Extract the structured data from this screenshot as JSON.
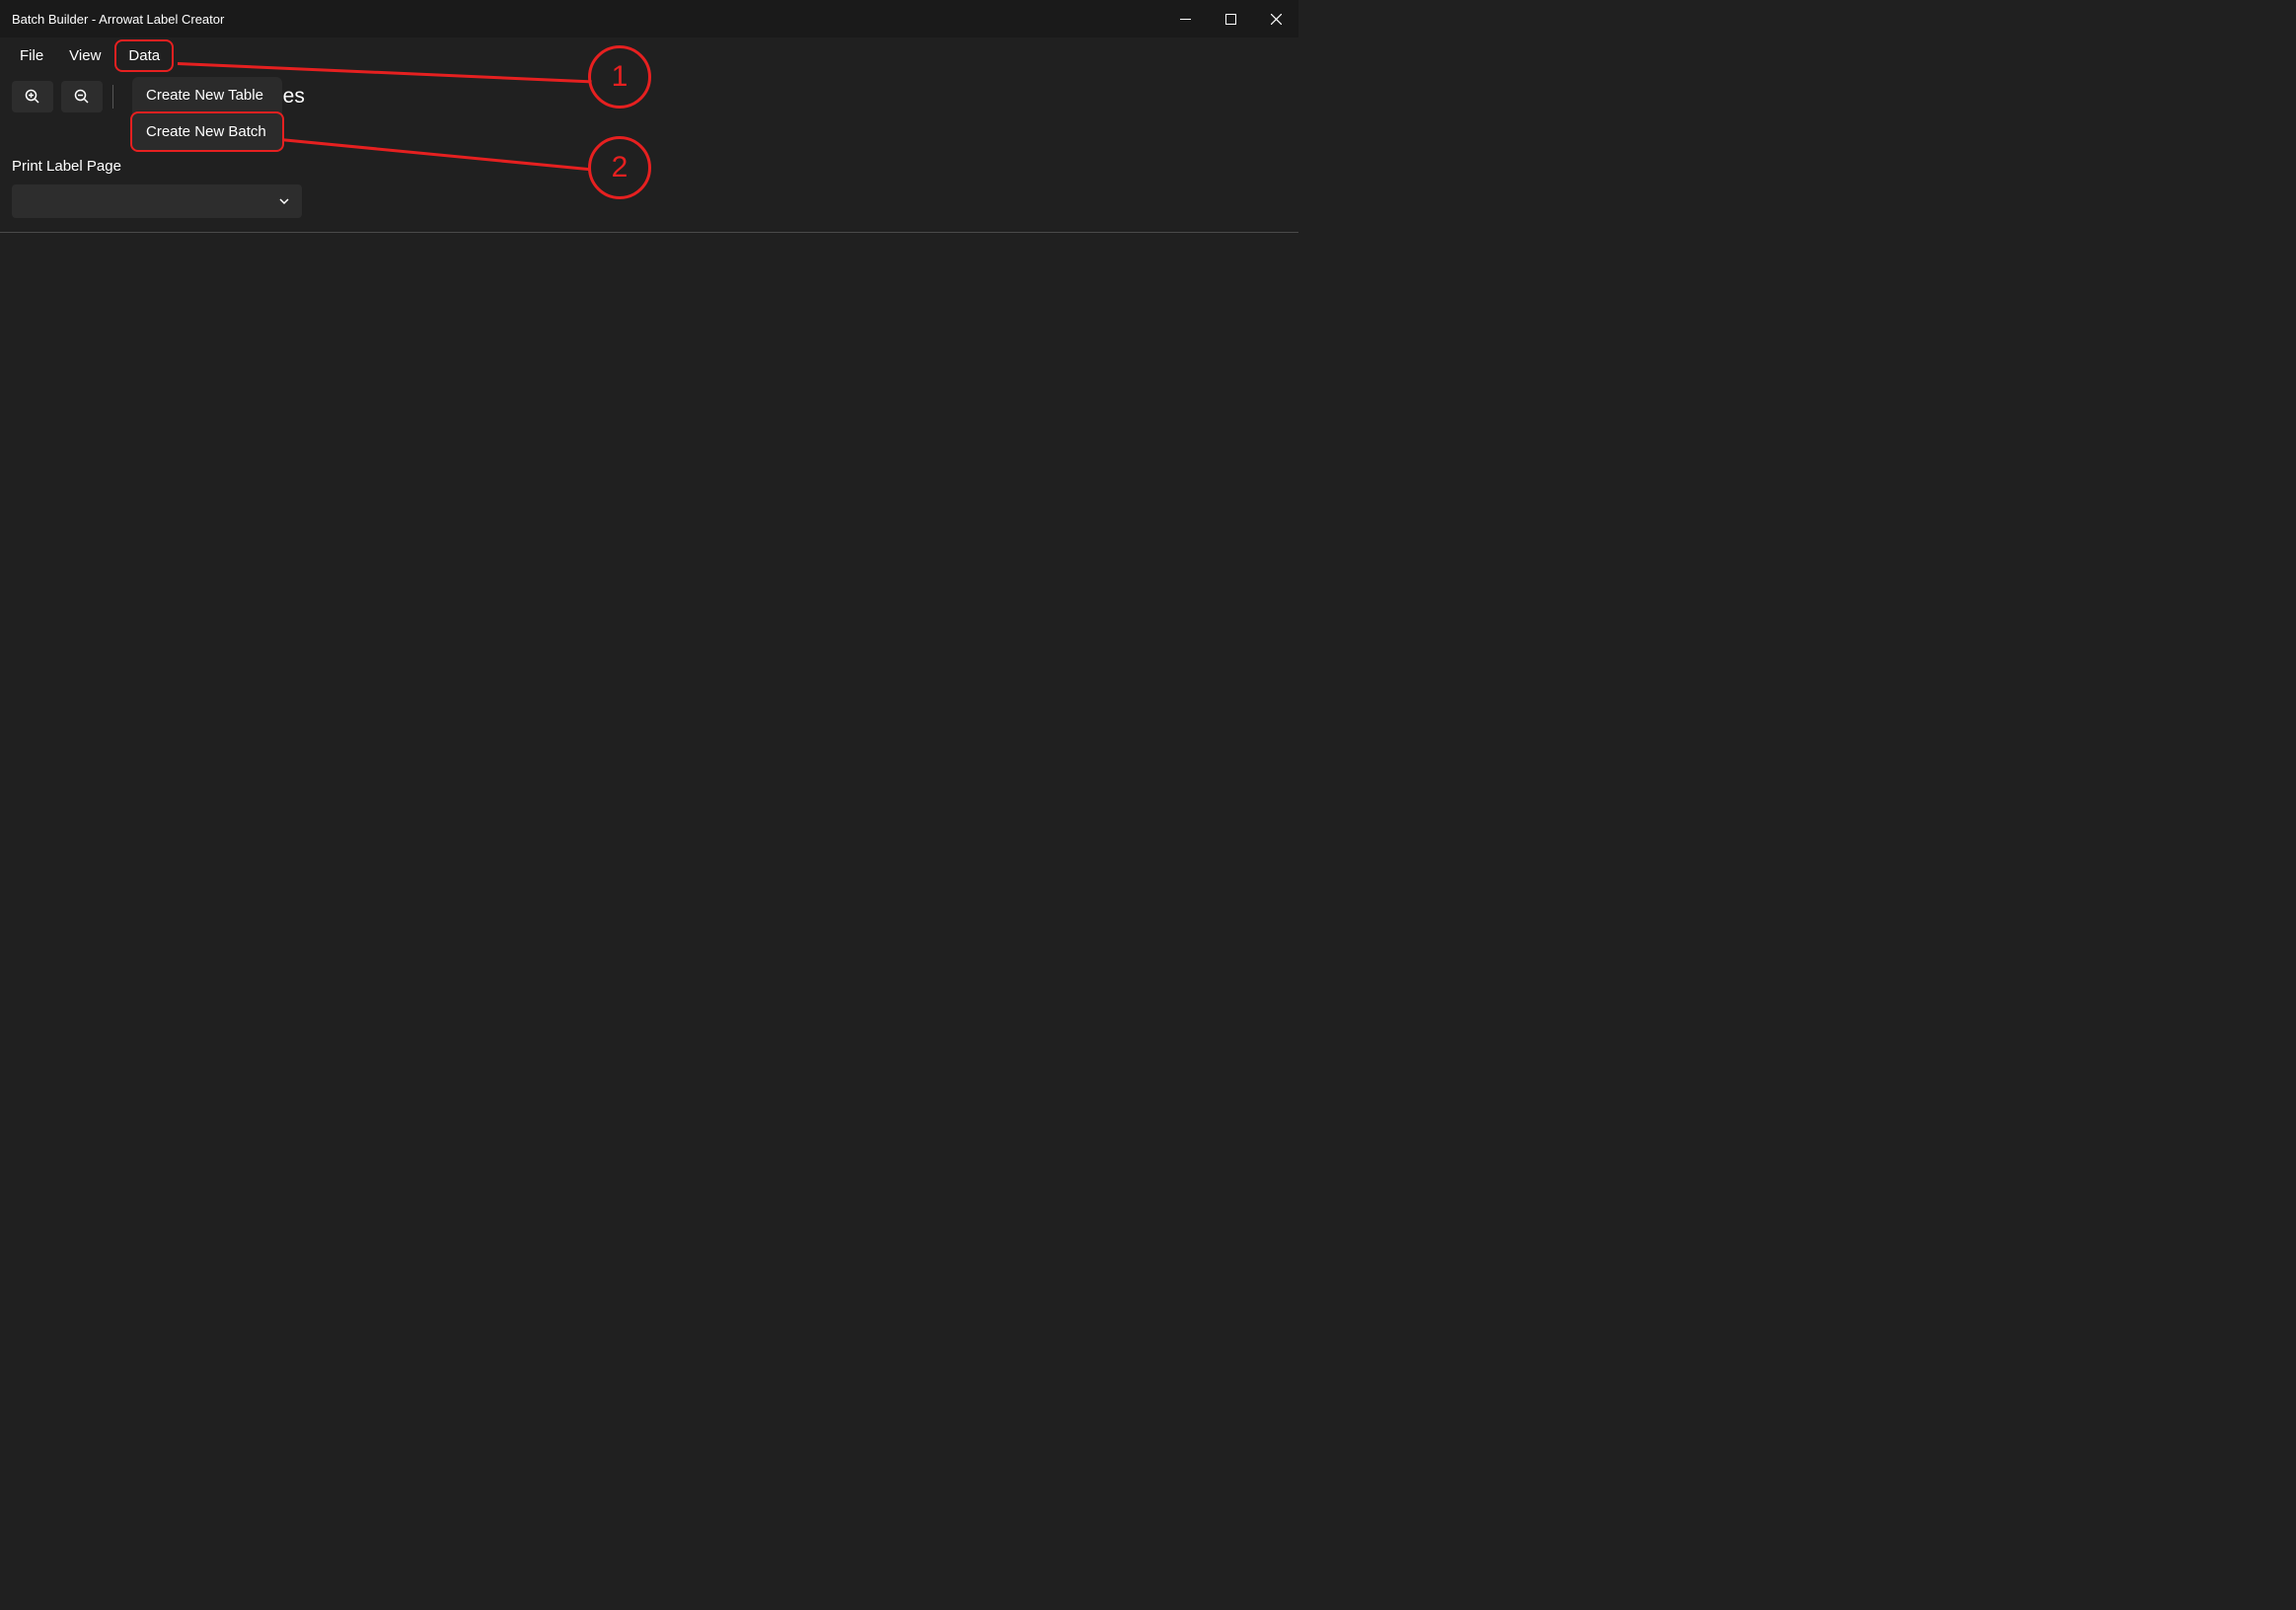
{
  "titlebar": {
    "title": "Batch Builder - Arrowat Label Creator"
  },
  "menubar": {
    "file": "File",
    "view": "View",
    "data": "Data"
  },
  "dropdown": {
    "create_table": "Create New Table",
    "create_batch": "Create New Batch"
  },
  "toolbar": {
    "label_pages_suffix": "ges",
    "print_label": "Print Label Page"
  },
  "select": {
    "value": ""
  },
  "annotations": {
    "one": "1",
    "two": "2"
  }
}
